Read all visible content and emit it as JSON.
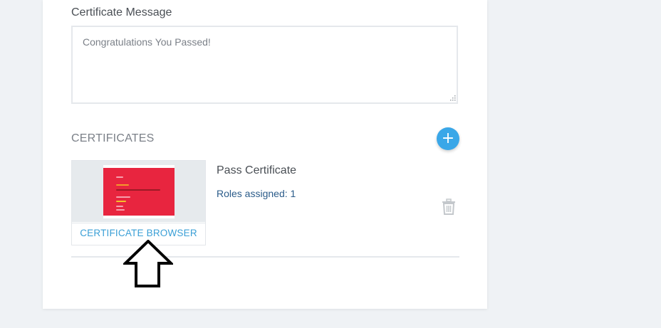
{
  "form": {
    "certificate_message": {
      "label": "Certificate Message",
      "value": "Congratulations You Passed!"
    }
  },
  "certificates": {
    "section_title": "CERTIFICATES",
    "add_button_label": "+",
    "items": [
      {
        "name": "Pass Certificate",
        "roles": "Roles assigned: 1",
        "browser_link": "CERTIFICATE BROWSER",
        "thumbnail_color": "#e8253f"
      }
    ]
  },
  "annotation": {
    "icon": "up-arrow-icon"
  },
  "colors": {
    "accent": "#3aa7e8",
    "link": "#3a9fd6",
    "roles_text": "#2b5c8a",
    "background": "#eff2f5"
  }
}
